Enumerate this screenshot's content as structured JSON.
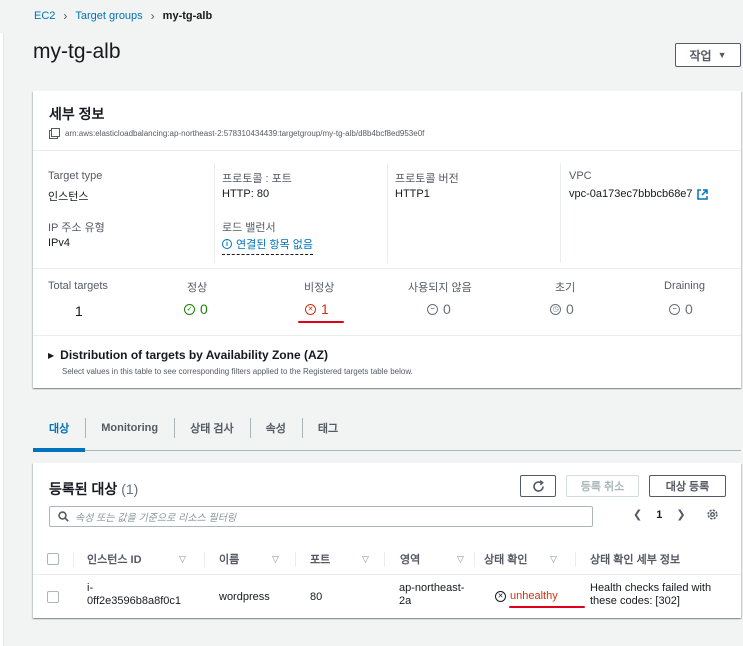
{
  "breadcrumb": {
    "items": [
      "EC2",
      "Target groups"
    ],
    "current": "my-tg-alb"
  },
  "page_title": "my-tg-alb",
  "actions_label": "작업",
  "details": {
    "title": "세부 정보",
    "arn": "arn:aws:elasticloadbalancing:ap-northeast-2:578310434439:targetgroup/my-tg-alb/d8b4bcf8ed953e0f",
    "fields": {
      "target_type_label": "Target type",
      "target_type_value": "인스턴스",
      "protocol_label": "프로토콜 : 포트",
      "protocol_value": "HTTP: 80",
      "protocol_version_label": "프로토콜 버전",
      "protocol_version_value": "HTTP1",
      "vpc_label": "VPC",
      "vpc_value": "vpc-0a173ec7bbbcb68e7",
      "ip_type_label": "IP 주소 유형",
      "ip_type_value": "IPv4",
      "lb_label": "로드 밸런서",
      "lb_value": "연결된 항목 없음"
    },
    "stats": {
      "total_label": "Total targets",
      "total_value": "1",
      "healthy_label": "정상",
      "healthy_value": "0",
      "unhealthy_label": "비정상",
      "unhealthy_value": "1",
      "unused_label": "사용되지 않음",
      "unused_value": "0",
      "initial_label": "초기",
      "initial_value": "0",
      "draining_label": "Draining",
      "draining_value": "0"
    },
    "az": {
      "title": "Distribution of targets by Availability Zone (AZ)",
      "subtitle": "Select values in this table to see corresponding filters applied to the Registered targets table below."
    }
  },
  "tabs": [
    "대상",
    "Monitoring",
    "상태 검사",
    "속성",
    "태그"
  ],
  "targets": {
    "title": "등록된 대상",
    "count": "(1)",
    "refresh_icon": "refresh-icon",
    "deregister_label": "등록 취소",
    "register_label": "대상 등록",
    "filter_placeholder": "속성 또는 값을 기준으로 리소스 필터링",
    "page_number": "1",
    "columns": [
      "인스턴스 ID",
      "이름",
      "포트",
      "영역",
      "상태 확인",
      "상태 확인 세부 정보"
    ],
    "rows": [
      {
        "instance_id": "i-0ff2e3596b8a8f0c1",
        "instance_id_line1": "i-",
        "instance_id_line2": "0ff2e3596b8a8f0c1",
        "name": "wordpress",
        "port": "80",
        "zone_line1": "ap-northeast-",
        "zone_line2": "2a",
        "health": "unhealthy",
        "details_line1": "Health checks failed with",
        "details_line2": "these codes: [302]"
      }
    ]
  },
  "colors": {
    "link": "#0073bb",
    "healthy": "#1d8102",
    "unhealthy": "#d13212",
    "annotation_red": "#e0001b"
  }
}
